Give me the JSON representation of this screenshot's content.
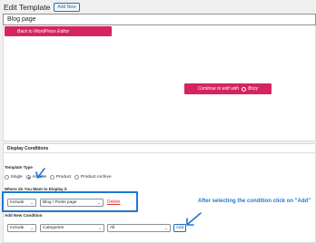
{
  "header": {
    "title": "Edit Template",
    "add_new_label": "Add New"
  },
  "title_input": {
    "value": "Blog page"
  },
  "editor": {
    "back_button": "Back to WordPress Editor",
    "continue_button": "Continue to edit with",
    "brand": "Brizy"
  },
  "conditions": {
    "panel_title": "Display Conditions",
    "template_type_label": "Template Type",
    "template_types": [
      "Single",
      "Archive",
      "Product",
      "Product Archive"
    ],
    "selected_type": "Archive",
    "where_label": "Where do You Want to Display it",
    "rule": {
      "mode": "Include",
      "target": "Blog / Posts page",
      "delete_label": "Delete"
    },
    "add_new_label": "Add New Condition",
    "new_rule": {
      "mode": "Include",
      "category": "Categories",
      "value": "All",
      "add_label": "Add"
    }
  },
  "annotation": {
    "text": "After selecting the condition click on \"Add\"",
    "color": "#1f78d1"
  },
  "colors": {
    "brizy_pink": "#d5245e",
    "wp_blue": "#2271b1",
    "annotation_blue": "#1f78d1",
    "delete_red": "#d63638"
  }
}
